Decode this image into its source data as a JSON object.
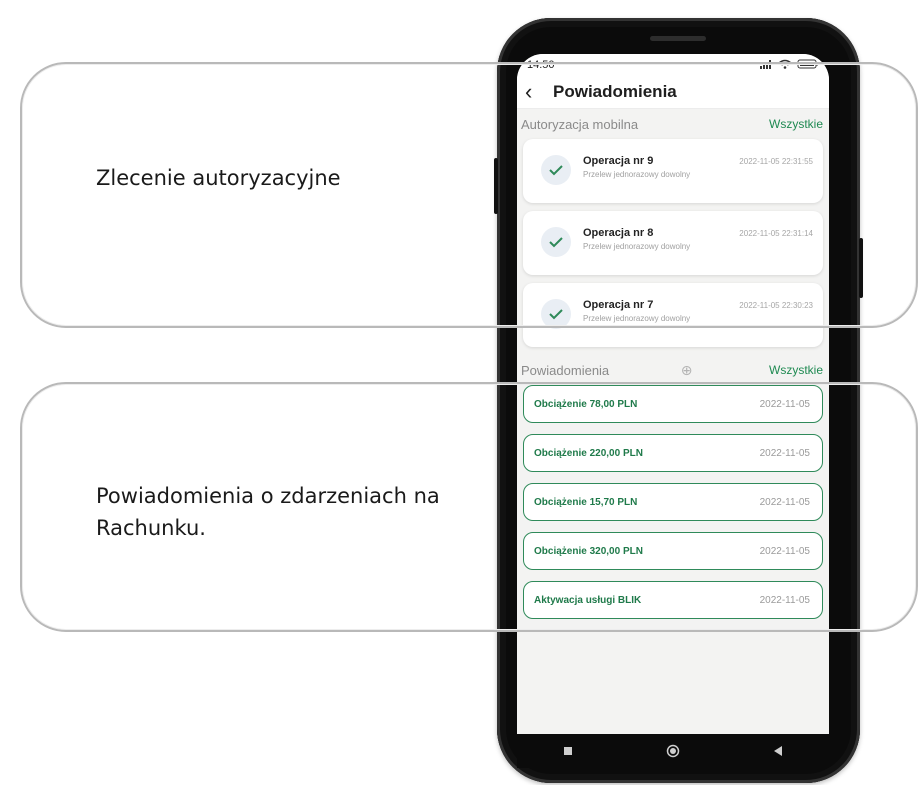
{
  "callouts": {
    "top": "Zlecenie autoryzacyjne",
    "bottom": "Powiadomienia o zdarzeniach na Rachunku."
  },
  "status_bar": {
    "time": "14:50"
  },
  "header": {
    "title": "Powiadomienia",
    "back_icon": "chevron-left-icon"
  },
  "auth_section": {
    "title": "Autoryzacja mobilna",
    "link": "Wszystkie",
    "items": [
      {
        "title": "Operacja nr 9",
        "subtitle": "Przelew jednorazowy dowolny",
        "date": "2022-11-05 22:31:55"
      },
      {
        "title": "Operacja nr 8",
        "subtitle": "Przelew jednorazowy dowolny",
        "date": "2022-11-05 22:31:14"
      },
      {
        "title": "Operacja nr 7",
        "subtitle": "Przelew jednorazowy dowolny",
        "date": "2022-11-05 22:30:23"
      }
    ]
  },
  "notif_section": {
    "title": "Powiadomienia",
    "link": "Wszystkie",
    "items": [
      {
        "title": "Obciążenie 78,00 PLN",
        "date": "2022-11-05"
      },
      {
        "title": "Obciążenie 220,00 PLN",
        "date": "2022-11-05"
      },
      {
        "title": "Obciążenie 15,70 PLN",
        "date": "2022-11-05"
      },
      {
        "title": "Obciążenie 320,00 PLN",
        "date": "2022-11-05"
      },
      {
        "title": "Aktywacja usługi BLIK",
        "date": "2022-11-05"
      }
    ]
  },
  "colors": {
    "accent": "#1f8a52",
    "card_border": "#2f8a5a",
    "callout_border": "#b9b9b9"
  }
}
